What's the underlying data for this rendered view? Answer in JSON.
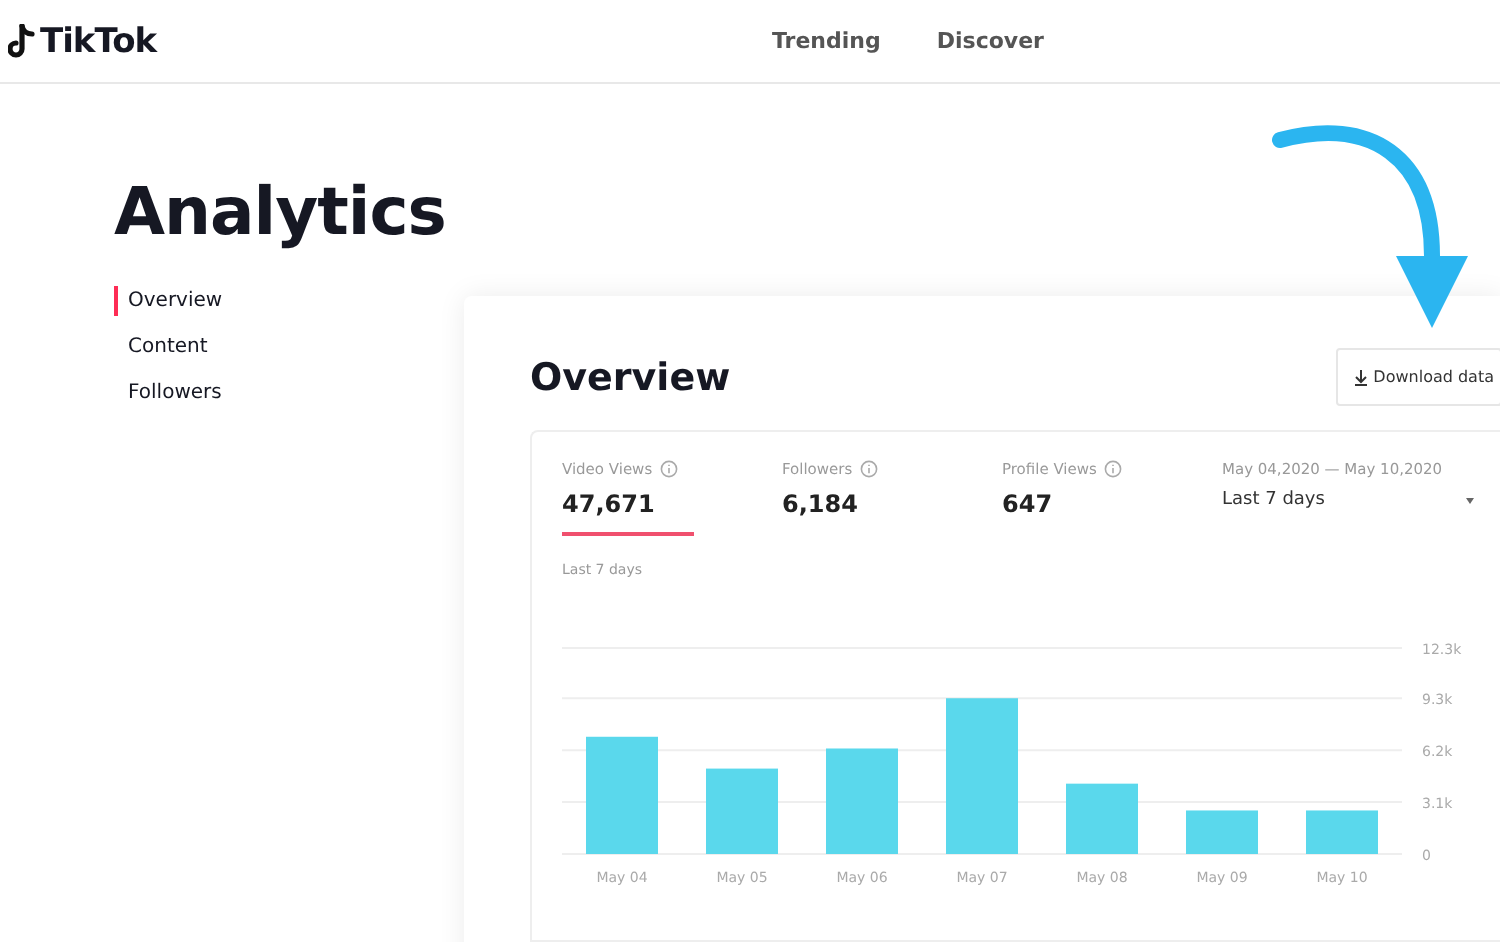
{
  "header": {
    "logo_text": "TikTok",
    "nav": [
      "Trending",
      "Discover"
    ]
  },
  "page_title": "Analytics",
  "sidebar": {
    "items": [
      {
        "label": "Overview",
        "selected": true
      },
      {
        "label": "Content",
        "selected": false
      },
      {
        "label": "Followers",
        "selected": false
      }
    ]
  },
  "overview": {
    "title": "Overview",
    "download_button": "Download data",
    "metrics": [
      {
        "label": "Video Views",
        "value": "47,671",
        "selected": true
      },
      {
        "label": "Followers",
        "value": "6,184",
        "selected": false
      },
      {
        "label": "Profile Views",
        "value": "647",
        "selected": false
      }
    ],
    "date_range": {
      "dates": "May 04,2020 — May 10,2020",
      "select_value": "Last 7 days"
    },
    "chart_label": "Last 7 days",
    "chart_data": {
      "type": "bar",
      "categories": [
        "May 04",
        "May 05",
        "May 06",
        "May 07",
        "May 08",
        "May 09",
        "May 10"
      ],
      "series": [
        {
          "color": "#5ad8ec",
          "values": [
            7000,
            5100,
            6300,
            9300,
            4200,
            2600,
            2600
          ]
        }
      ],
      "grid": true,
      "ylim": [
        0,
        12300
      ],
      "yticks": [
        {
          "value": 0,
          "label": "0"
        },
        {
          "value": 3100,
          "label": "3.1k"
        },
        {
          "value": 6200,
          "label": "6.2k"
        },
        {
          "value": 9300,
          "label": "9.3k"
        },
        {
          "value": 12300,
          "label": "12.3k"
        }
      ]
    }
  }
}
